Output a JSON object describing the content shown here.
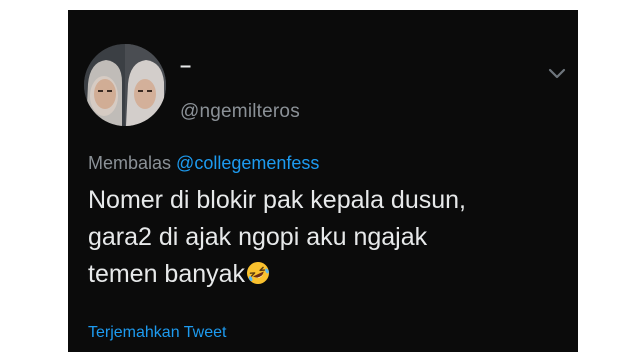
{
  "tweet": {
    "display_name": "–",
    "handle": "@ngemilteros",
    "reply_prefix": "Membalas",
    "reply_mention": "@collegemenfess",
    "text_lines": [
      "Nomer di blokir pak kepala dusun,",
      "gara2 di ajak ngopi aku ngajak",
      "temen banyak"
    ],
    "emoji_name": "rolling-on-the-floor-laughing-icon",
    "translate_label": "Terjemahkan Tweet",
    "more_icon": "chevron-down-icon"
  },
  "colors": {
    "background": "#0b0b0b",
    "primary_text": "#e7e9ea",
    "secondary_text": "#8b9197",
    "accent": "#1d9bf0",
    "page": "#ffffff"
  }
}
